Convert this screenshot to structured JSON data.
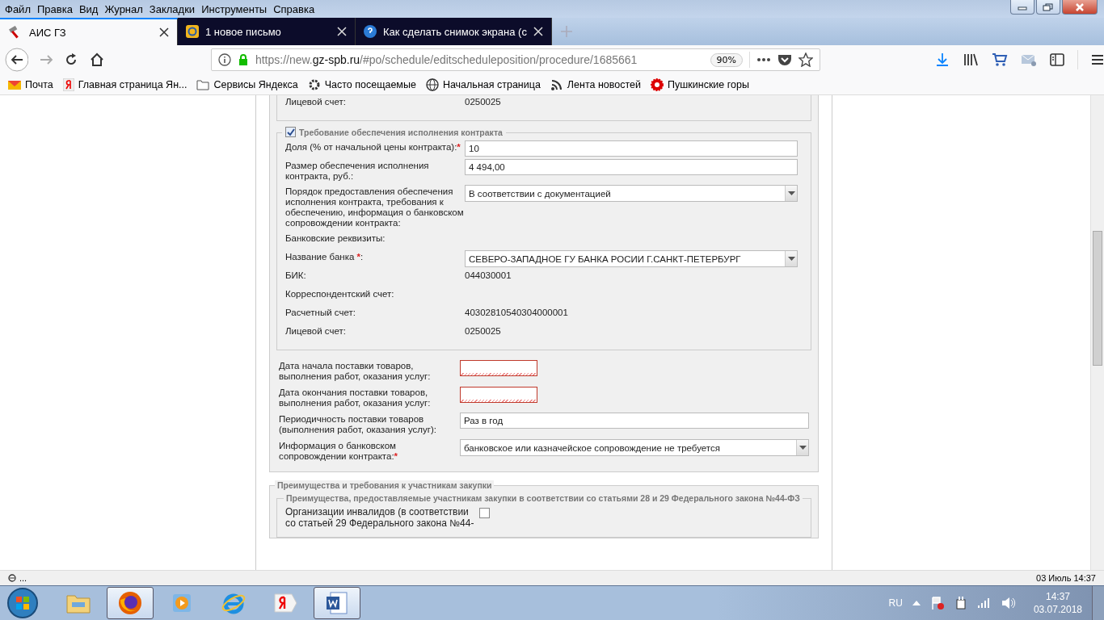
{
  "menu": [
    "Файл",
    "Правка",
    "Вид",
    "Журнал",
    "Закладки",
    "Инструменты",
    "Справка"
  ],
  "tabs": [
    {
      "title": "АИС ГЗ",
      "selected": true
    },
    {
      "title": "1 новое письмо",
      "selected": false
    },
    {
      "title": "Как сделать снимок экрана (с",
      "selected": false
    }
  ],
  "address": {
    "scheme": "https://new.",
    "host": "gz-spb.ru",
    "path": "/#po/schedule/editscheduleposition/procedure/1685661",
    "zoom": "90%"
  },
  "bookmarks": [
    {
      "label": "Почта"
    },
    {
      "label": "Главная страница Ян..."
    },
    {
      "label": "Сервисы Яндекса"
    },
    {
      "label": "Часто посещаемые"
    },
    {
      "label": "Начальная страница"
    },
    {
      "label": "Лента новостей"
    },
    {
      "label": "Пушкинские горы"
    }
  ],
  "top_rows": [
    {
      "label": "Лицевой счет:",
      "value": "0250025"
    }
  ],
  "security_section": {
    "title": "Требование обеспечения исполнения контракта",
    "checked": true,
    "fields": [
      {
        "kind": "input",
        "label": "Доля (% от начальной цены контракта):",
        "mark": "*",
        "value": "10"
      },
      {
        "kind": "input",
        "label": "Размер обеспечения исполнения контракта, руб.:",
        "value": "4 494,00"
      },
      {
        "kind": "select",
        "label": "Порядок предоставления обеспечения исполнения контракта, требования к обеспечению, информация о банковском сопровождении контракта:",
        "value": "В соответствии с документацией"
      },
      {
        "kind": "text",
        "label": "Банковские реквизиты:"
      },
      {
        "kind": "select",
        "label": "Название банка ",
        "mark": "*",
        "suffix": ":",
        "value": "СЕВЕРО-ЗАПАДНОЕ ГУ БАНКА РОСИИ Г.САНКТ-ПЕТЕРБУРГ"
      },
      {
        "kind": "text",
        "label": "БИК:",
        "value": "044030001"
      },
      {
        "kind": "text",
        "label": "Корреспондентский счет:"
      },
      {
        "kind": "text",
        "label": "Расчетный счет:",
        "value": "40302810540304000001"
      },
      {
        "kind": "text",
        "label": "Лицевой счет:",
        "value": "0250025"
      }
    ]
  },
  "delivery_fields": [
    {
      "kind": "date",
      "label": "Дата начала поставки товаров, выполнения работ, оказания услуг:",
      "invalid": true
    },
    {
      "kind": "date",
      "label": "Дата окончания поставки товаров, выполнения работ, оказания услуг:",
      "invalid": true
    },
    {
      "kind": "input",
      "label": "Периодичность поставки товаров (выполнения работ, оказания услуг):",
      "value": "Раз в год"
    },
    {
      "kind": "select",
      "label": "Информация о банковском сопровождении контракта:",
      "mark": "*",
      "value": "банковское или казначейское сопровождение не требуется"
    }
  ],
  "advantages_section": {
    "title": "Преимущества и требования к участникам закупки",
    "subtitle": "Преимущества, предоставляемые участникам закупки в соответствии со статьями 28 и 29 Федерального закона №44-ФЗ",
    "fields": [
      {
        "kind": "checkbox",
        "label": "Организации инвалидов (в соответствии со статьей 29 Федерального закона №44-",
        "checked": false
      }
    ]
  },
  "status_bar": {
    "left": "...",
    "right": "03 Июль 14:37"
  },
  "taskbar": {
    "apps": [
      {
        "kind": "explorer",
        "selected": false
      },
      {
        "kind": "firefox",
        "selected": true
      },
      {
        "kind": "player",
        "selected": false
      },
      {
        "kind": "ie",
        "selected": false
      },
      {
        "kind": "yandex",
        "selected": false
      },
      {
        "kind": "word",
        "selected": true
      }
    ],
    "language": "RU",
    "time": "14:37",
    "date": "03.07.2018"
  }
}
